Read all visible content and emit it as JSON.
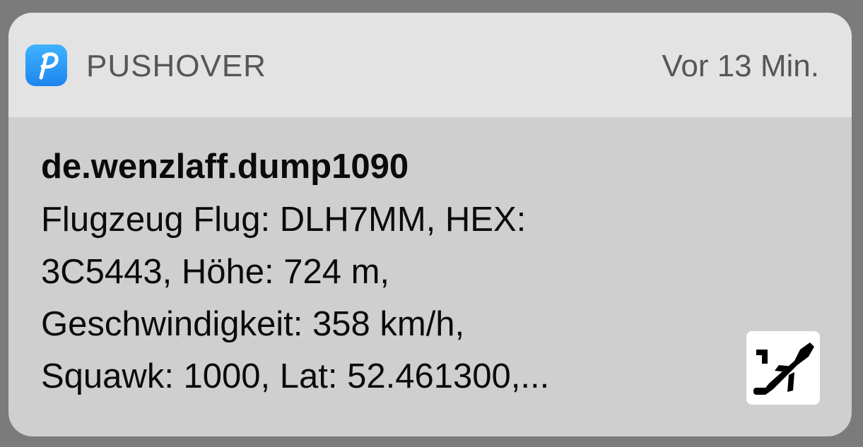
{
  "notification": {
    "app_name": "PUSHOVER",
    "time_ago": "Vor 13 Min.",
    "app_icon": {
      "name": "pushover-logo-icon",
      "letter": "P",
      "color": "#2a95f4"
    },
    "title": "de.wenzlaff.dump1090",
    "message_lines": [
      "Flugzeug Flug: DLH7MM, HEX:",
      "3C5443, Höhe: 724 m,",
      "Geschwindigkeit: 358 km/h,",
      "Squawk: 1000, Lat: 52.461300,..."
    ],
    "attachment_icon": "airplane-takeoff-icon"
  }
}
